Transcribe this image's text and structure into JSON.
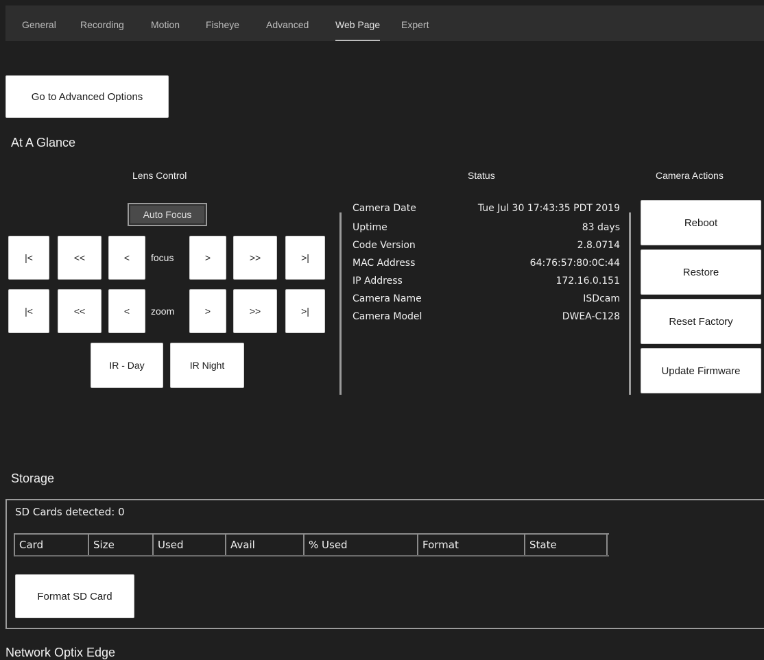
{
  "nav": {
    "tabs": [
      {
        "label": "General"
      },
      {
        "label": "Recording"
      },
      {
        "label": "Motion"
      },
      {
        "label": "Fisheye"
      },
      {
        "label": "Advanced"
      },
      {
        "label": "Web Page",
        "active": true
      },
      {
        "label": "Expert"
      }
    ]
  },
  "advanced_button": "Go to Advanced Options",
  "at_a_glance": {
    "title": "At A Glance",
    "lens": {
      "heading": "Lens Control",
      "auto_focus": "Auto Focus",
      "focus_label": "focus",
      "zoom_label": "zoom",
      "buttons": {
        "first": "|<",
        "fast_back": "<<",
        "back": "<",
        "fwd": ">",
        "fast_fwd": ">>",
        "last": ">|"
      },
      "ir_day": "IR - Day",
      "ir_night": "IR Night"
    },
    "status": {
      "heading": "Status",
      "rows": [
        {
          "key": "Camera Date",
          "value": "Tue Jul 30 17:43:35 PDT 2019"
        },
        {
          "key": "Uptime",
          "value": "83 days"
        },
        {
          "key": "Code Version",
          "value": "2.8.0714"
        },
        {
          "key": "MAC Address",
          "value": "64:76:57:80:0C:44"
        },
        {
          "key": "IP Address",
          "value": "172.16.0.151"
        },
        {
          "key": "Camera Name",
          "value": "ISDcam"
        },
        {
          "key": "Camera Model",
          "value": "DWEA-C128"
        }
      ]
    },
    "actions": {
      "heading": "Camera Actions",
      "reboot": "Reboot",
      "restore": "Restore",
      "reset_factory": "Reset Factory",
      "update_firmware": "Update Firmware"
    }
  },
  "storage": {
    "title": "Storage",
    "sd_detected": "SD Cards detected: 0",
    "columns": [
      "Card",
      "Size",
      "Used",
      "Avail",
      "% Used",
      "Format",
      "State"
    ],
    "format_button": "Format SD Card"
  },
  "next_section_title": "Network Optix Edge"
}
